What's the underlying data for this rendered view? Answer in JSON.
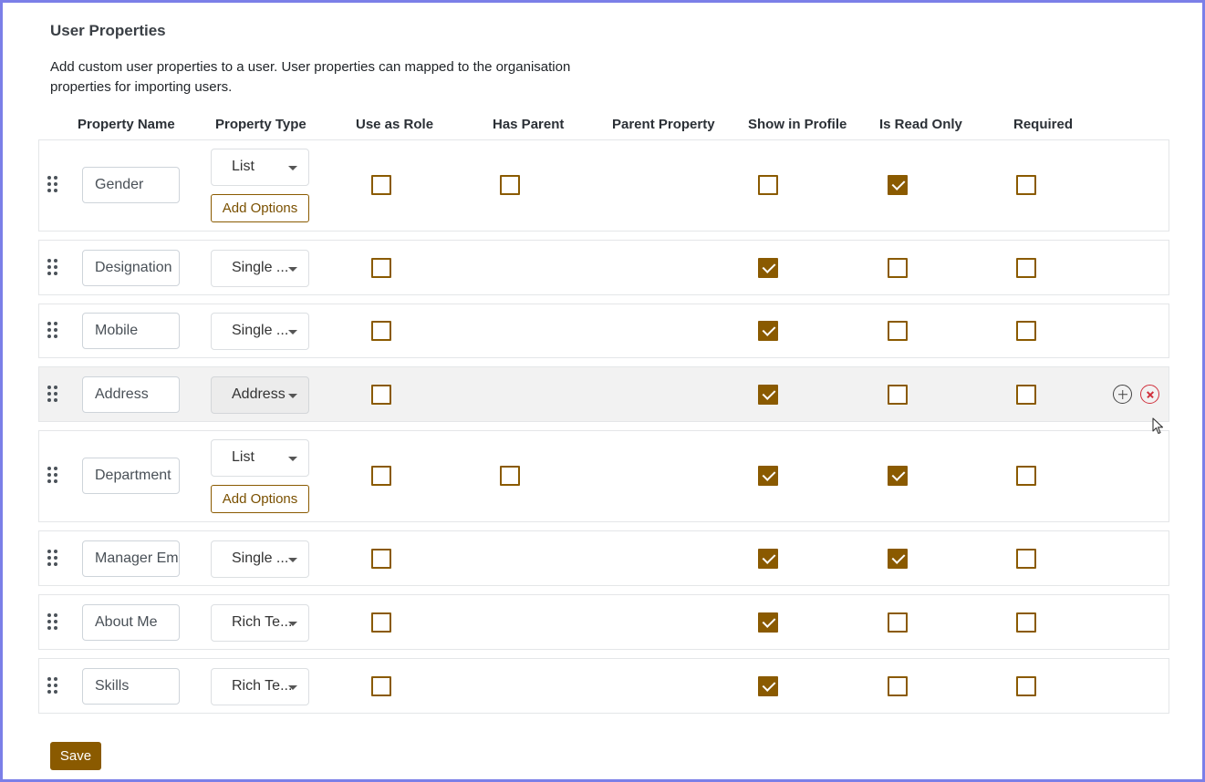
{
  "page": {
    "title": "User Properties",
    "description": "Add custom user properties to a user. User properties can mapped to the organisation properties for importing users."
  },
  "columns": {
    "property_name": "Property Name",
    "property_type": "Property Type",
    "use_as_role": "Use as Role",
    "has_parent": "Has Parent",
    "parent_property": "Parent Property",
    "show_in_profile": "Show in Profile",
    "is_read_only": "Is Read Only",
    "required": "Required"
  },
  "add_options_label": "Add Options",
  "rows": [
    {
      "name": "Gender",
      "type": "List",
      "use_as_role": false,
      "has_parent": false,
      "show_in_profile": false,
      "is_read_only": true,
      "required": false
    },
    {
      "name": "Designation",
      "type": "Single ...",
      "use_as_role": false,
      "show_in_profile": true,
      "is_read_only": false,
      "required": false
    },
    {
      "name": "Mobile",
      "type": "Single ...",
      "use_as_role": false,
      "show_in_profile": true,
      "is_read_only": false,
      "required": false
    },
    {
      "name": "Address",
      "type": "Address",
      "use_as_role": false,
      "show_in_profile": true,
      "is_read_only": false,
      "required": false,
      "hovered": true
    },
    {
      "name": "Department",
      "type": "List",
      "use_as_role": false,
      "has_parent": false,
      "show_in_profile": true,
      "is_read_only": true,
      "required": false
    },
    {
      "name": "Manager Email",
      "type": "Single ...",
      "use_as_role": false,
      "show_in_profile": true,
      "is_read_only": true,
      "required": false
    },
    {
      "name": "About Me",
      "type": "Rich Te...",
      "use_as_role": false,
      "show_in_profile": true,
      "is_read_only": false,
      "required": false
    },
    {
      "name": "Skills",
      "type": "Rich Te...",
      "use_as_role": false,
      "show_in_profile": true,
      "is_read_only": false,
      "required": false
    }
  ],
  "save_label": "Save",
  "colors": {
    "accent": "#8a5a00",
    "danger": "#d0303c",
    "frame": "#7b7fe8"
  },
  "icons": {
    "drag": "drag-handle-icon",
    "add": "plus-circle-icon",
    "remove": "close-circle-icon"
  }
}
